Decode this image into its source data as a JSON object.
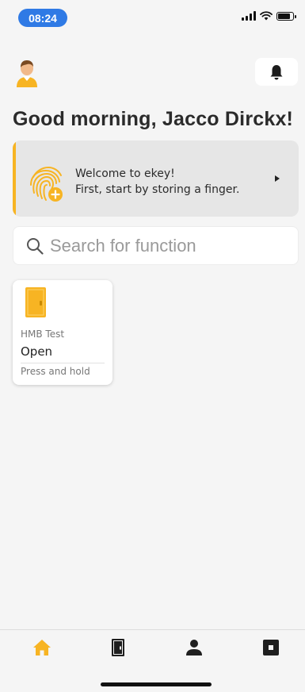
{
  "status_bar": {
    "time": "08:24",
    "battery_level": 0.85
  },
  "header": {
    "greeting": "Good morning, Jacco Dirckx!",
    "avatar_icon": "user-avatar-icon",
    "bell_icon": "bell-icon"
  },
  "welcome_card": {
    "line1": "Welcome to ekey!",
    "line2": "First, start by storing a finger.",
    "icon": "fingerprint-add-icon",
    "accent_color": "#f7b423"
  },
  "search": {
    "placeholder": "Search for function",
    "value": ""
  },
  "functions": [
    {
      "icon": "door-icon",
      "device": "HMB Test",
      "action": "Open",
      "hint": "Press and hold"
    }
  ],
  "bottom_nav": {
    "items": [
      {
        "icon": "home-icon",
        "active": true
      },
      {
        "icon": "door-icon",
        "active": false
      },
      {
        "icon": "person-icon",
        "active": false
      },
      {
        "icon": "square-icon",
        "active": false
      }
    ],
    "active_color": "#f7b423"
  }
}
